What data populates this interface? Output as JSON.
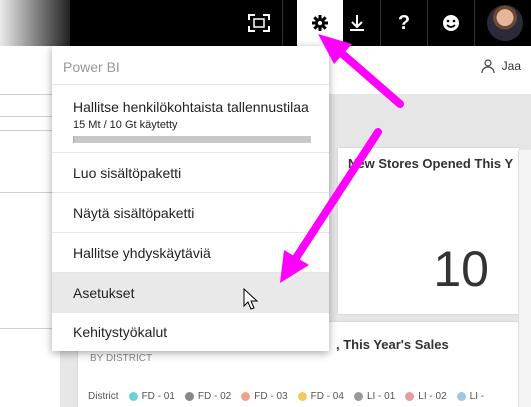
{
  "topbar": {
    "icons": [
      "fullscreen-icon",
      "gear-icon",
      "download-icon",
      "help-icon",
      "smiley-icon",
      "avatar"
    ],
    "help_glyph": "?"
  },
  "share_label": "Jaa",
  "menu": {
    "header": "Power BI",
    "storage": {
      "label": "Hallitse henkilökohtaista tallennustilaa",
      "usage": "15 Mt / 10 Gt käytetty",
      "used_fraction": 0.0015
    },
    "items": [
      "Luo sisältöpaketti",
      "Näytä sisältöpaketti",
      "Hallitse yhdyskäytäviä",
      "Asetukset",
      "Kehitystyökalut"
    ],
    "highlighted_index": 3
  },
  "tiles": {
    "stores_title": "New Stores Opened This Y",
    "stores_value": "10",
    "sales_title": ", This Year's Sales",
    "sales_subtitle": "BY DISTRICT",
    "legend_label": "District",
    "legend": [
      {
        "label": "FD - 01",
        "color": "#6fd0d3"
      },
      {
        "label": "FD - 02",
        "color": "#888888"
      },
      {
        "label": "FD - 03",
        "color": "#f4a08f"
      },
      {
        "label": "FD - 04",
        "color": "#f2cc5a"
      },
      {
        "label": "LI - 01",
        "color": "#9a9a9a"
      },
      {
        "label": "LI - 02",
        "color": "#e99aa0"
      },
      {
        "label": "LI -",
        "color": "#9fc6e8"
      }
    ]
  },
  "colors": {
    "arrow": "#ff00ff",
    "topbar": "#000000",
    "highlight": "#e9e9e9"
  }
}
